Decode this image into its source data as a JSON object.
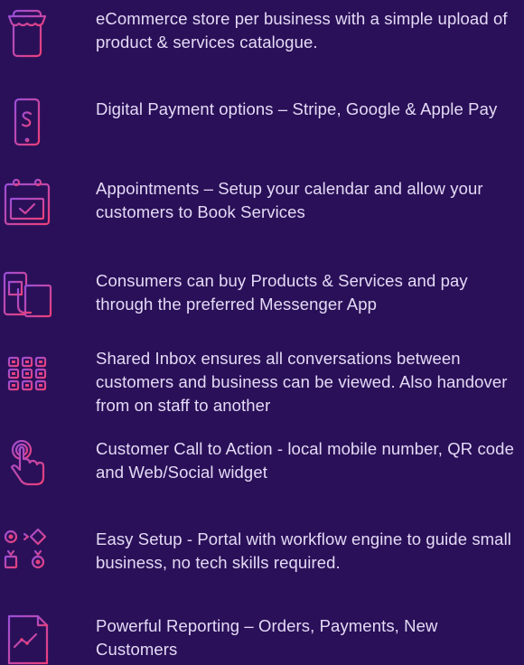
{
  "features": [
    {
      "icon": "storefront-phone-icon",
      "text": "eCommerce store per business with a simple upload of product & services catalogue."
    },
    {
      "icon": "mobile-payment-icon",
      "text": "Digital Payment options – Stripe, Google & Apple Pay"
    },
    {
      "icon": "calendar-check-icon",
      "text": "Appointments – Setup your calendar and allow your customers to Book Services"
    },
    {
      "icon": "messenger-shopping-icon",
      "text": "Consumers can buy Products & Services and pay through the preferred Messenger App"
    },
    {
      "icon": "grid-inbox-icon",
      "text": "Shared Inbox ensures all conversations between customers and business can be viewed. Also handover from on staff to another"
    },
    {
      "icon": "tap-hand-icon",
      "text": "Customer Call to Action - local mobile number, QR code and Web/Social widget"
    },
    {
      "icon": "workflow-icon",
      "text": "Easy Setup - Portal with workflow engine to guide small business, no tech skills required."
    },
    {
      "icon": "report-document-icon",
      "text": "Powerful Reporting – Orders, Payments, New Customers"
    }
  ],
  "colors": {
    "background": "#2a1058",
    "icon_pink": "#e8407e",
    "icon_purple": "#9a4fd8",
    "text": "#e4daf6"
  }
}
